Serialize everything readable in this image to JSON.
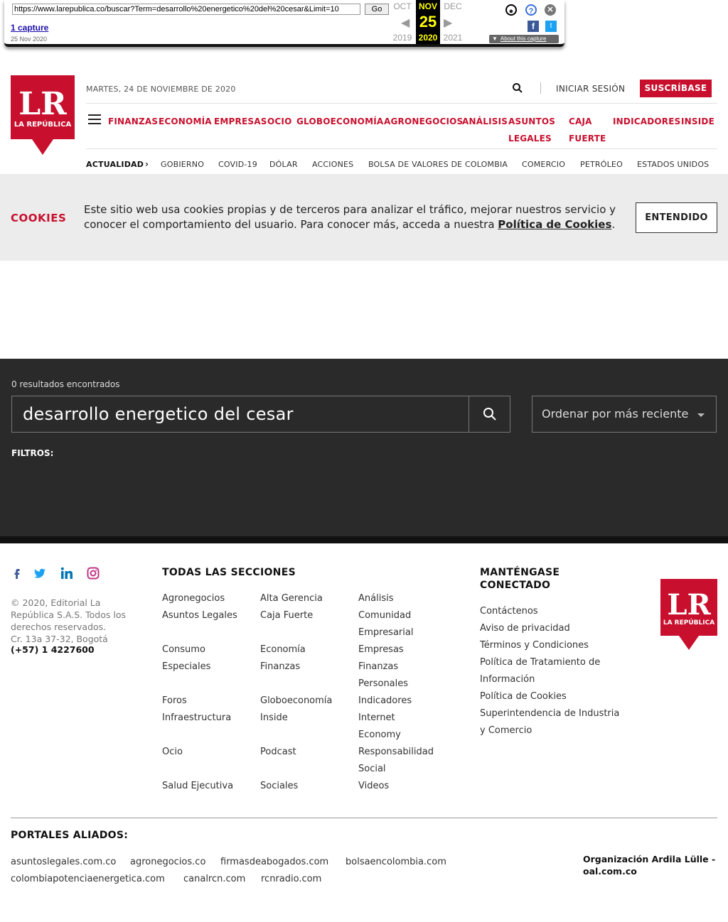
{
  "wayback": {
    "url": "https://www.larepublica.co/buscar?Term=desarrollo%20energetico%20del%20cesar&Limit=10",
    "go_label": "Go",
    "captures": "1 capture",
    "capture_date": "25 Nov 2020",
    "prev_month": "OCT",
    "cur_month": "NOV",
    "next_month": "DEC",
    "cur_day": "25",
    "prev_year": "2019",
    "cur_year": "2020",
    "next_year": "2021",
    "about": "About this capture"
  },
  "header": {
    "logo_text": "LR",
    "logo_sub": "LA REPÚBLICA",
    "date": "MARTES, 24 DE NOVIEMBRE DE 2020",
    "login": "INICIAR SESIÓN",
    "subscribe": "SUSCRÍBASE"
  },
  "nav": [
    "FINANZAS",
    "ECONOMÍA",
    "EMPRESAS",
    "OCIO",
    "GLOBOECONOMÍA",
    "AGRONEGOCIOS",
    "ANÁLISIS",
    "ASUNTOS",
    "LEGALES",
    "CAJA",
    "FUERTE",
    "INDICADORES",
    "INSIDE"
  ],
  "subnav": [
    "ACTUALIDAD",
    "GOBIERNO",
    "COVID-19",
    "DÓLAR",
    "ACCIONES",
    "BOLSA DE VALORES DE COLOMBIA",
    "COMERCIO",
    "PETRÓLEO",
    "ESTADOS UNIDOS"
  ],
  "cookies": {
    "title": "COOKIES",
    "text": "Este sitio web usa cookies propias y de terceros para analizar el tráfico, mejorar nuestros servicio y conocer el comportamiento del usuario. Para conocer más, acceda a nuestra ",
    "link": "Política de Cookies",
    "period": ".",
    "button": "ENTENDIDO"
  },
  "search": {
    "results": "0 resultados encontrados",
    "term": "desarrollo energetico del cesar",
    "sort": "Ordenar por más reciente",
    "filters": "FILTROS:"
  },
  "footer": {
    "copyright": "© 2020, Editorial La República S.A.S. Todos los derechos reservados.",
    "address": "Cr. 13a 37-32, Bogotá",
    "phone": "(+57) 1 4227600",
    "sections_title": "TODAS LAS SECCIONES",
    "col1": [
      "Agronegocios",
      "Asuntos Legales",
      "Consumo",
      "Especiales",
      "Foros",
      "Infraestructura",
      "Ocio",
      "Salud Ejecutiva"
    ],
    "col2": [
      "Alta Gerencia",
      "Caja Fuerte",
      "Economía",
      "Finanzas",
      "Globoeconomía",
      "Inside",
      "Podcast",
      "Sociales"
    ],
    "col3": [
      "Análisis",
      "Comunidad",
      "Empresarial",
      "Empresas",
      "Finanzas",
      "Personales",
      "Indicadores",
      "Internet",
      "Economy",
      "Responsabilidad",
      "Social",
      "Videos"
    ],
    "connect_title_1": "MANTÉNGASE",
    "connect_title_2": "CONECTADO",
    "connect": [
      "Contáctenos",
      "Aviso de privacidad",
      "Términos y Condiciones",
      "Política de Tratamiento de",
      "Información",
      "Política de Cookies",
      "Superintendencia de Industria",
      "y Comercio"
    ],
    "partners_title": "PORTALES ALIADOS:",
    "partners_row1": [
      "asuntoslegales.com.co",
      "agronegocios.co",
      "firmasdeabogados.com",
      "bolsaencolombia.com"
    ],
    "partners_row2": [
      "colombiapotenciaenergetica.com",
      "canalrcn.com",
      "rcnradio.com"
    ],
    "org": "Organización Ardila Lülle - oal.com.co"
  },
  "colors": {
    "brand_red": "#c8102e",
    "dark_bg": "#2a2a2a",
    "cookie_bg": "#ececec"
  }
}
